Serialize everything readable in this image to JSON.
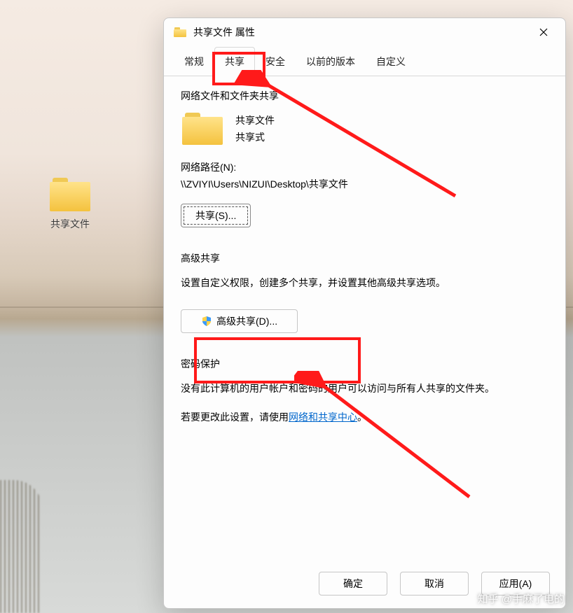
{
  "desktop": {
    "icon_label": "共享文件"
  },
  "dialog": {
    "title": "共享文件 属性",
    "tabs": {
      "general": "常规",
      "share": "共享",
      "security": "安全",
      "previous": "以前的版本",
      "custom": "自定义"
    },
    "section1": {
      "title": "网络文件和文件夹共享",
      "folder_name": "共享文件",
      "share_state": "共享式",
      "network_path_label": "网络路径(N):",
      "network_path": "\\\\ZVIYI\\Users\\NIZUI\\Desktop\\共享文件",
      "share_button": "共享(S)..."
    },
    "section2": {
      "title": "高级共享",
      "desc": "设置自定义权限，创建多个共享，并设置其他高级共享选项。",
      "adv_button": "高级共享(D)..."
    },
    "section3": {
      "title": "密码保护",
      "desc": "没有此计算机的用户帐户和密码的用户可以访问与所有人共享的文件夹。",
      "change_prefix": "若要更改此设置，请使用",
      "link": "网络和共享中心",
      "suffix": "。"
    },
    "footer": {
      "ok": "确定",
      "cancel": "取消",
      "apply": "应用(A)"
    }
  },
  "watermark": "知乎 @手麻了电的"
}
